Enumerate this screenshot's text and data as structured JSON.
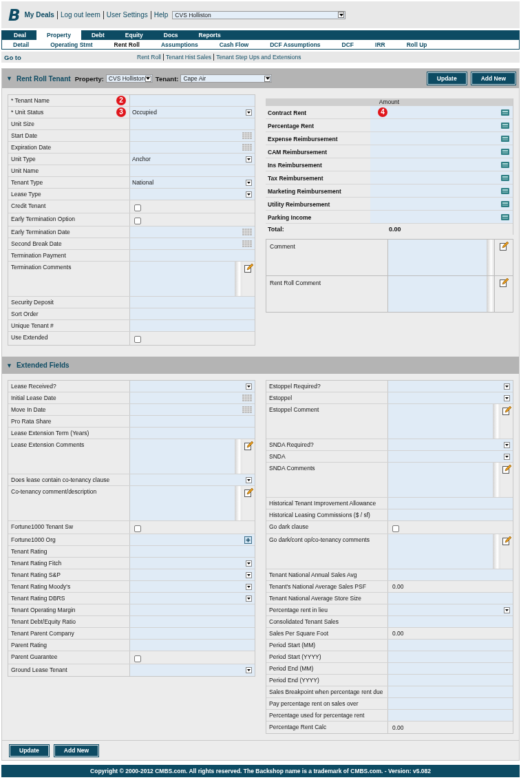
{
  "header": {
    "logo": "B",
    "links": [
      "My Deals",
      "Log out leem",
      "User Settings",
      "Help"
    ],
    "deal_select": "CVS Holliston"
  },
  "tabs": [
    {
      "label": "Deal",
      "selected": false
    },
    {
      "label": "Property",
      "selected": true
    },
    {
      "label": "Debt",
      "selected": false
    },
    {
      "label": "Equity",
      "selected": false
    },
    {
      "label": "Docs",
      "selected": false
    },
    {
      "label": "Reports",
      "selected": false
    }
  ],
  "subtabs": [
    {
      "label": "Detail",
      "selected": false
    },
    {
      "label": "Operating Stmt",
      "selected": false
    },
    {
      "label": "Rent Roll",
      "selected": true
    },
    {
      "label": "Assumptions",
      "selected": false
    },
    {
      "label": "Cash Flow",
      "selected": false
    },
    {
      "label": "DCF Assumptions",
      "selected": false
    },
    {
      "label": "DCF",
      "selected": false
    },
    {
      "label": "IRR",
      "selected": false
    },
    {
      "label": "Roll Up",
      "selected": false
    }
  ],
  "goto": {
    "label": "Go to",
    "links": [
      "Rent Roll",
      "Tenant Hist Sales",
      "Tenant Step Ups and Extensions"
    ]
  },
  "section": {
    "toggle": "▼",
    "title": "Rent Roll Tenant",
    "property_label": "Property:",
    "property": "CVS Holliston",
    "tenant_label": "Tenant:",
    "tenant": "Cape Air",
    "buttons": [
      "Update",
      "Add New"
    ]
  },
  "tenant_fields": [
    {
      "label": "* Tenant Name",
      "kind": "text",
      "callout": "2"
    },
    {
      "label": "* Unit Status",
      "kind": "select",
      "value": "Occupied",
      "callout": "3"
    },
    {
      "label": "Unit Size",
      "kind": "text"
    },
    {
      "label": "Start Date",
      "kind": "date"
    },
    {
      "label": "Expiration Date",
      "kind": "date"
    },
    {
      "label": "Unit Type",
      "kind": "select",
      "value": "Anchor"
    },
    {
      "label": "Unit Name",
      "kind": "text"
    },
    {
      "label": "Tenant Type",
      "kind": "select",
      "value": "National"
    },
    {
      "label": "Lease Type",
      "kind": "select"
    },
    {
      "label": "Credit Tenant",
      "kind": "check",
      "checked": false
    },
    {
      "label": "Early Termination Option",
      "kind": "check",
      "checked": false
    },
    {
      "label": "Early Termination Date",
      "kind": "date"
    },
    {
      "label": "Second Break Date",
      "kind": "date"
    },
    {
      "label": "Termination Payment",
      "kind": "text"
    },
    {
      "label": "Termination Comments",
      "kind": "memo"
    },
    {
      "label": "Security Deposit",
      "kind": "text"
    },
    {
      "label": "Sort Order",
      "kind": "text"
    },
    {
      "label": "Unique Tenant #",
      "kind": "text"
    },
    {
      "label": "Use Extended",
      "kind": "check",
      "checked": false
    }
  ],
  "amounts": {
    "header": "Amount",
    "rows": [
      {
        "label": "Contract Rent",
        "callout": "4"
      },
      {
        "label": "Percentage Rent"
      },
      {
        "label": "Expense Reimbursement"
      },
      {
        "label": "CAM Reimbursement"
      },
      {
        "label": "Ins Reimbursement"
      },
      {
        "label": "Tax Reimbursement"
      },
      {
        "label": "Marketing Reimbursement"
      },
      {
        "label": "Utility Reimbursement"
      },
      {
        "label": "Parking Income"
      }
    ],
    "total_label": "Total:",
    "total": "0.00"
  },
  "comments": [
    {
      "label": "Comment"
    },
    {
      "label": "Rent Roll Comment"
    }
  ],
  "extended": {
    "toggle": "▼",
    "title": "Extended Fields",
    "left": [
      {
        "label": "Lease Received?",
        "kind": "select"
      },
      {
        "label": "Initial Lease Date",
        "kind": "date"
      },
      {
        "label": "Move In Date",
        "kind": "date"
      },
      {
        "label": "Pro Rata Share",
        "kind": "text"
      },
      {
        "label": "Lease Extension Term (Years)",
        "kind": "text"
      },
      {
        "label": "Lease Extension Comments",
        "kind": "memo"
      },
      {
        "label": "Does lease contain co-tenancy clause",
        "kind": "select"
      },
      {
        "label": "Co-tenancy comment/description",
        "kind": "memo"
      },
      {
        "label": "Fortune1000 Tenant Sw",
        "kind": "check",
        "checked": false
      },
      {
        "label": "Fortune1000 Org",
        "kind": "plus"
      },
      {
        "label": "Tenant Rating",
        "kind": "text"
      },
      {
        "label": "Tenant Rating Fitch",
        "kind": "select"
      },
      {
        "label": "Tenant Rating S&P",
        "kind": "select"
      },
      {
        "label": "Tenant Rating Moody's",
        "kind": "select"
      },
      {
        "label": "Tenant Rating DBRS",
        "kind": "select"
      },
      {
        "label": "Tenant Operating Margin",
        "kind": "text"
      },
      {
        "label": "Tenant Debt/Equity Ratio",
        "kind": "text"
      },
      {
        "label": "Tenant Parent Company",
        "kind": "text"
      },
      {
        "label": "Parent Rating",
        "kind": "text"
      },
      {
        "label": "Parent Guarantee",
        "kind": "check",
        "checked": false
      },
      {
        "label": "Ground Lease Tenant",
        "kind": "select"
      }
    ],
    "right": [
      {
        "label": "Estoppel Required?",
        "kind": "select"
      },
      {
        "label": "Estoppel",
        "kind": "select"
      },
      {
        "label": "Estoppel Comment",
        "kind": "memo"
      },
      {
        "label": "SNDA Required?",
        "kind": "select"
      },
      {
        "label": "SNDA",
        "kind": "select"
      },
      {
        "label": "SNDA Comments",
        "kind": "memo"
      },
      {
        "label": "Historical Tenant Improvement Allowance",
        "kind": "text"
      },
      {
        "label": "Historical Leasing Commissions ($ / sf)",
        "kind": "text"
      },
      {
        "label": "Go dark clause",
        "kind": "check",
        "checked": false
      },
      {
        "label": "Go dark/cont op/co-tenancy comments",
        "kind": "memo"
      },
      {
        "label": "Tenant National Annual Sales Avg",
        "kind": "text"
      },
      {
        "label": "Tenant's National Average Sales PSF",
        "kind": "readonly",
        "value": "0.00"
      },
      {
        "label": "Tenant National Average Store Size",
        "kind": "text"
      },
      {
        "label": "Percentage rent in lieu",
        "kind": "select"
      },
      {
        "label": "Consolidated Tenant Sales",
        "kind": "text"
      },
      {
        "label": "Sales Per Square Foot",
        "kind": "readonly",
        "value": "0.00"
      },
      {
        "label": "Period Start (MM)",
        "kind": "text"
      },
      {
        "label": "Period Start (YYYY)",
        "kind": "text"
      },
      {
        "label": "Period End (MM)",
        "kind": "text"
      },
      {
        "label": "Period End (YYYY)",
        "kind": "text"
      },
      {
        "label": "Sales Breakpoint when percentage rent due",
        "kind": "text"
      },
      {
        "label": "Pay percentage rent on sales over",
        "kind": "text"
      },
      {
        "label": "Percentage used for percentage rent",
        "kind": "text"
      },
      {
        "label": "Percentage Rent Calc",
        "kind": "readonly",
        "value": "0.00"
      }
    ]
  },
  "bottom_buttons": [
    "Update",
    "Add New"
  ],
  "footer": "Copyright © 2000-2012 CMBS.com. All rights reserved. The Backshop name is a trademark of CMBS.com. - Version: v5.082"
}
